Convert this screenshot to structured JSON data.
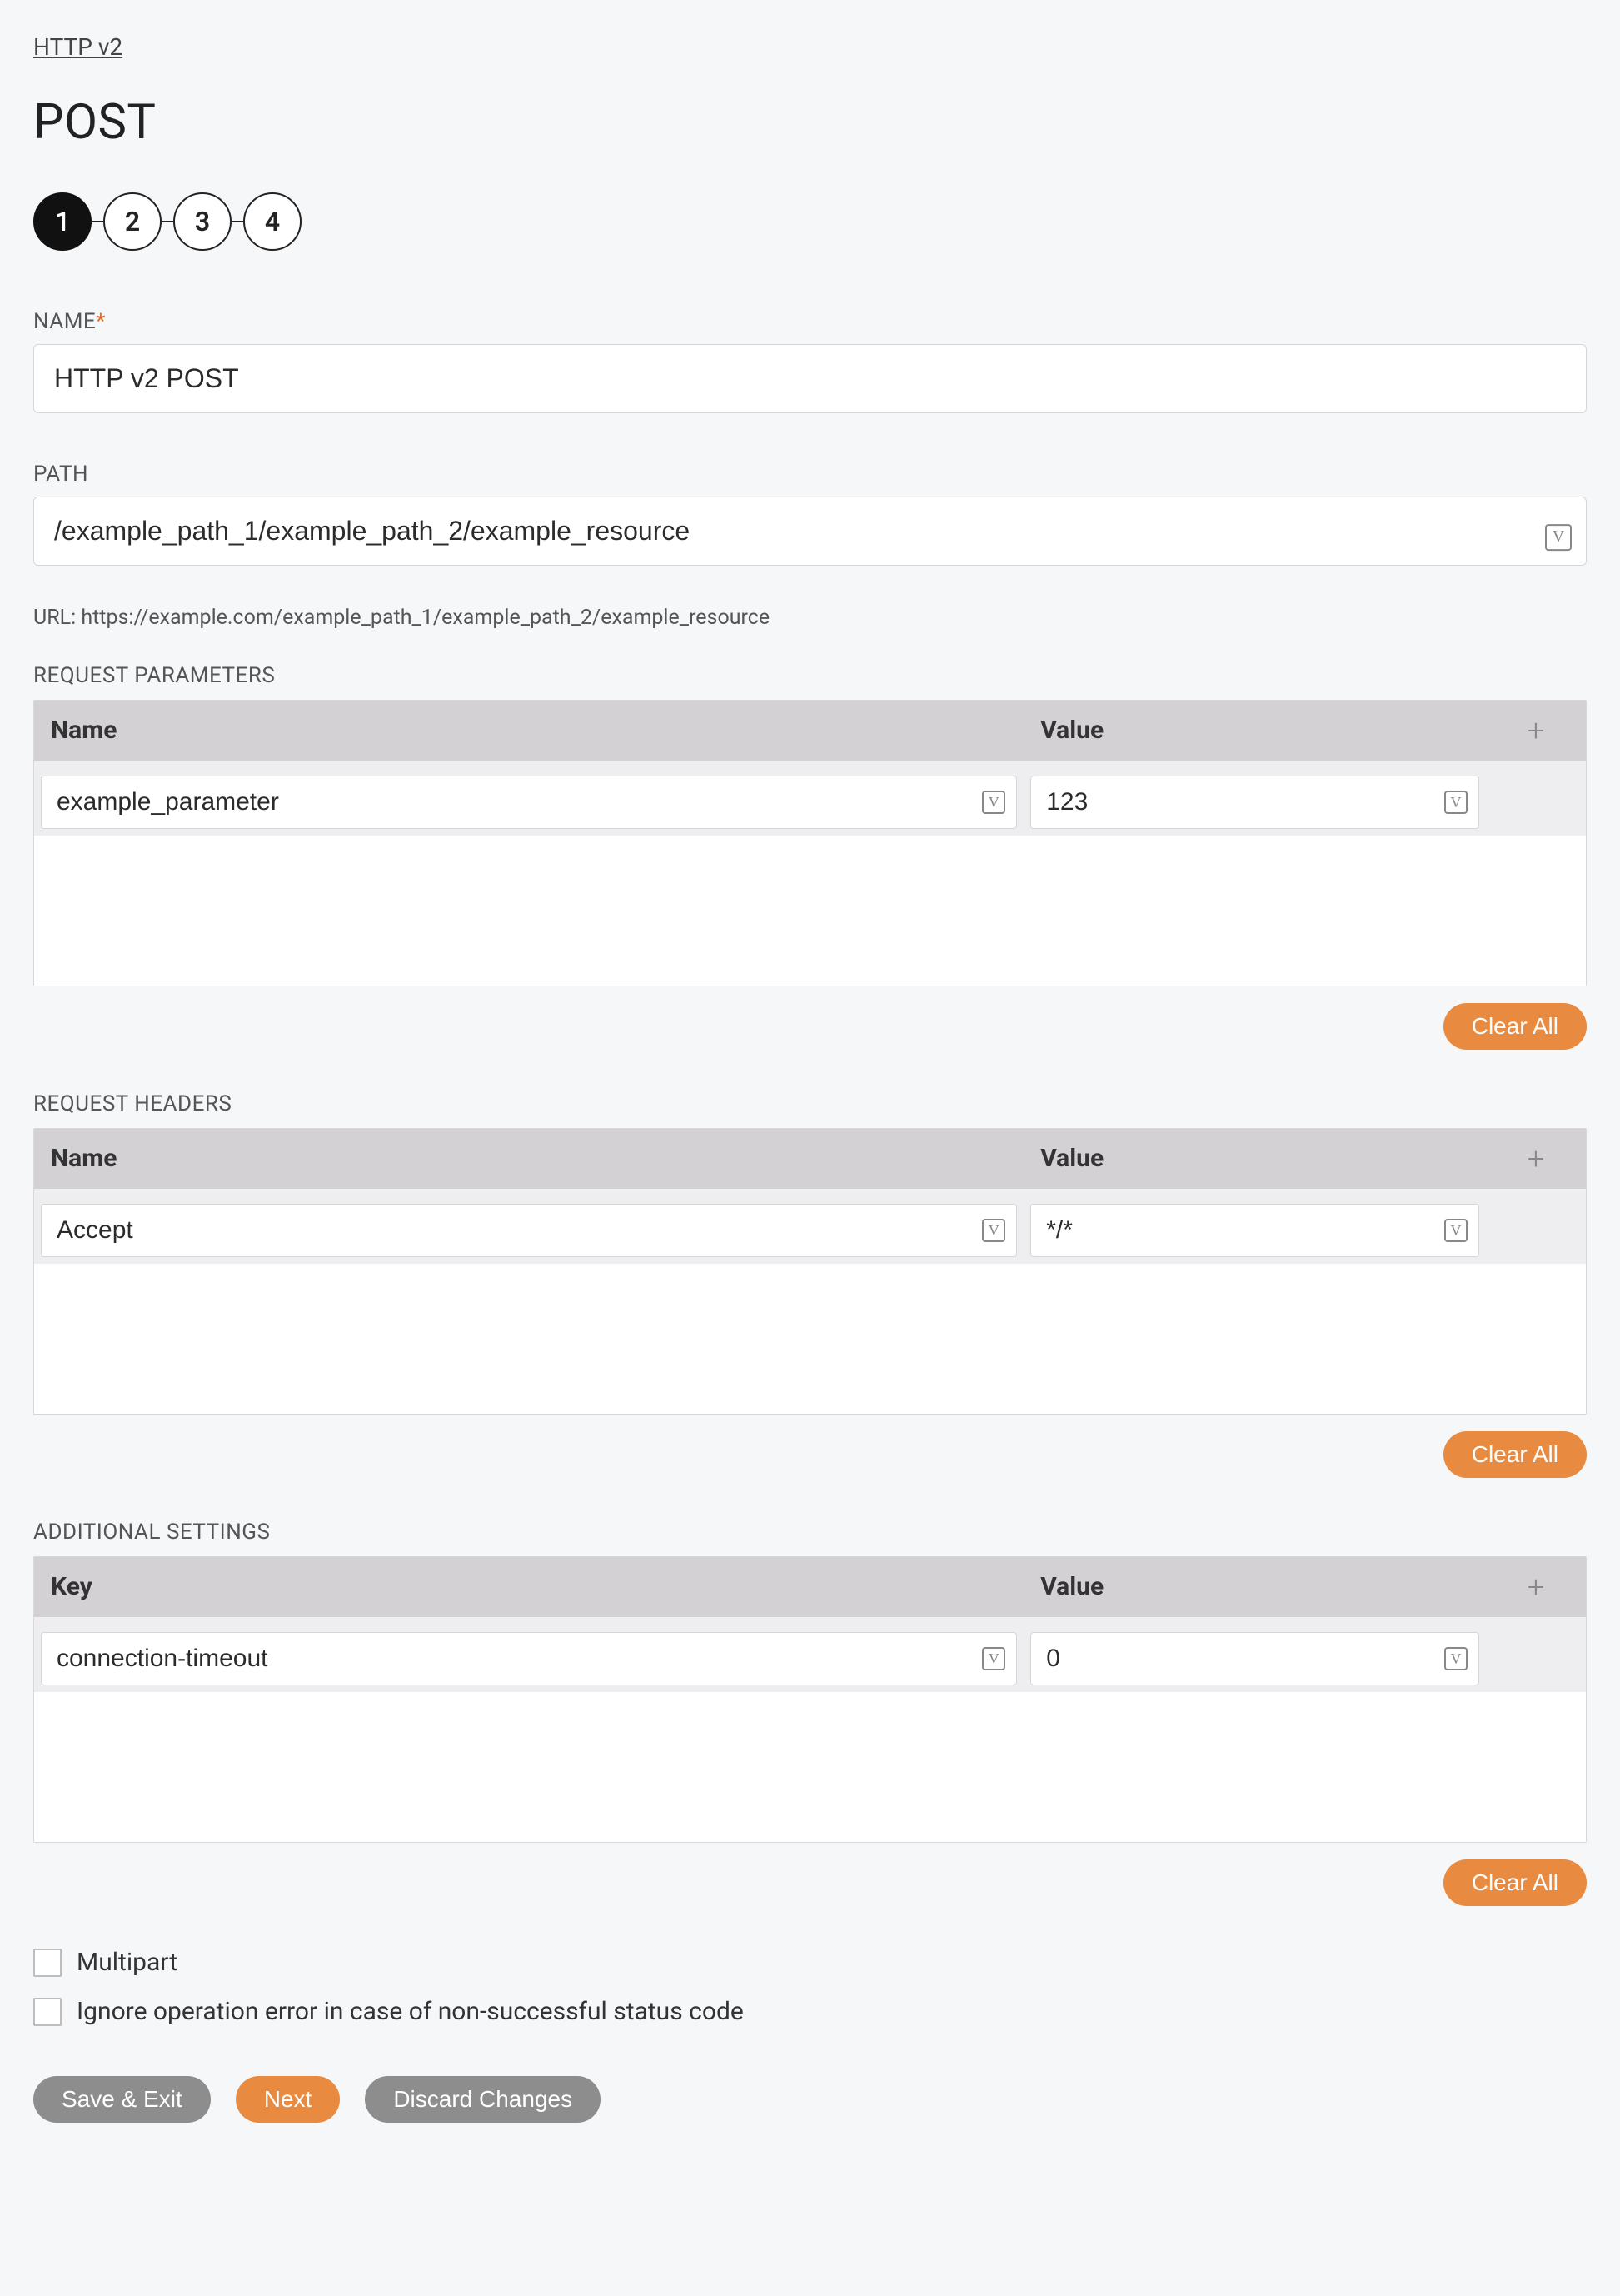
{
  "breadcrumb": "HTTP v2",
  "page_title": "POST",
  "stepper": {
    "steps": [
      "1",
      "2",
      "3",
      "4"
    ],
    "active_index": 0
  },
  "name_field": {
    "label": "NAME",
    "required_marker": "*",
    "value": "HTTP v2 POST"
  },
  "path_field": {
    "label": "PATH",
    "value": "/example_path_1/example_path_2/example_resource",
    "hint": "URL: https://example.com/example_path_1/example_path_2/example_resource",
    "suffix_icon_glyph": "V"
  },
  "request_parameters": {
    "label": "REQUEST PARAMETERS",
    "columns": {
      "name": "Name",
      "value": "Value"
    },
    "rows": [
      {
        "name": "example_parameter",
        "value": "123"
      }
    ],
    "clear_label": "Clear All"
  },
  "request_headers": {
    "label": "REQUEST HEADERS",
    "columns": {
      "name": "Name",
      "value": "Value"
    },
    "rows": [
      {
        "name": "Accept",
        "value": "*/*"
      }
    ],
    "clear_label": "Clear All"
  },
  "additional_settings": {
    "label": "ADDITIONAL SETTINGS",
    "columns": {
      "name": "Key",
      "value": "Value"
    },
    "rows": [
      {
        "name": "connection-timeout",
        "value": "0"
      }
    ],
    "clear_label": "Clear All"
  },
  "checkboxes": {
    "multipart": "Multipart",
    "ignore_error": "Ignore operation error in case of non-successful status code"
  },
  "footer": {
    "save_exit": "Save & Exit",
    "next": "Next",
    "discard": "Discard Changes"
  },
  "icons": {
    "variable_glyph": "V",
    "plus": "+"
  }
}
